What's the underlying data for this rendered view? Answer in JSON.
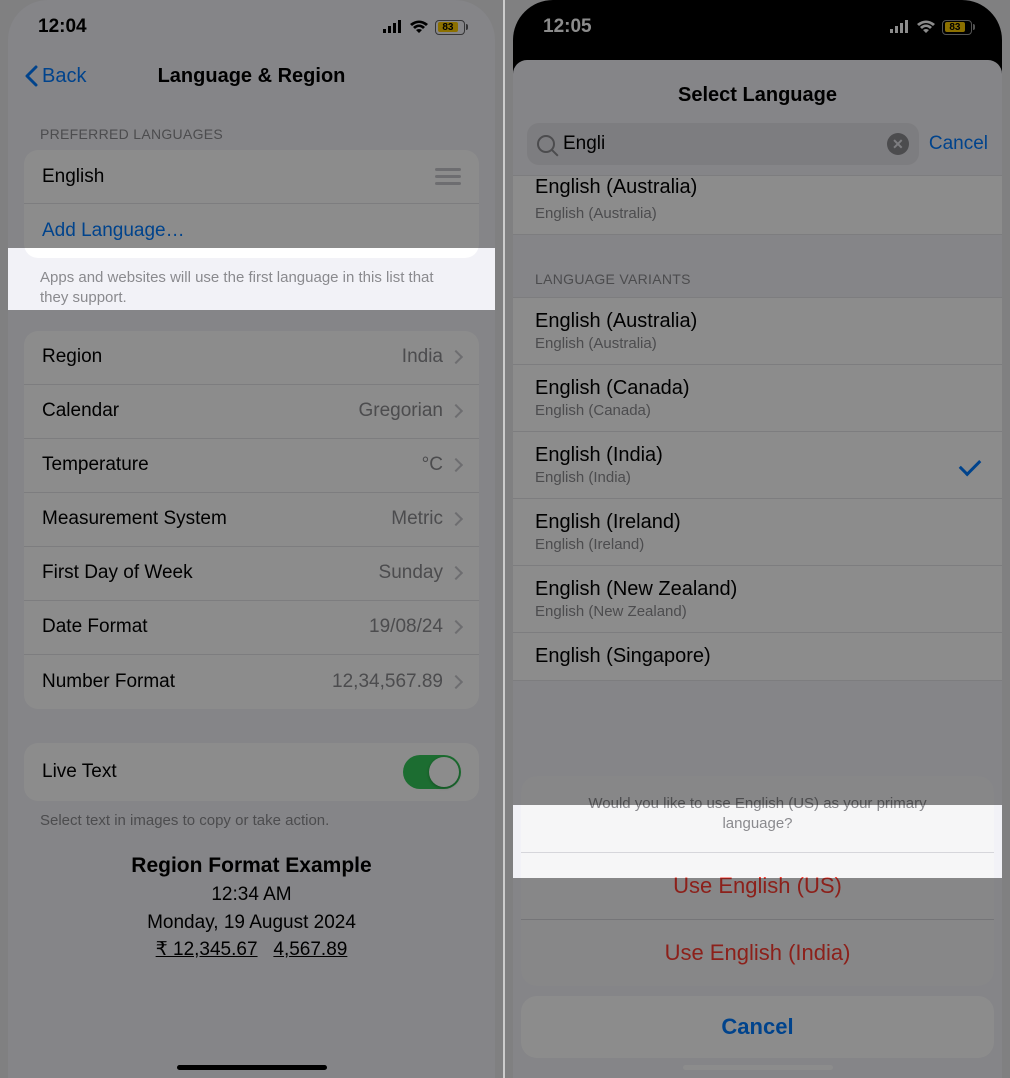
{
  "left": {
    "status": {
      "time": "12:04",
      "battery": "83",
      "battery_pct": 83
    },
    "nav": {
      "back": "Back",
      "title": "Language & Region"
    },
    "pref_header": "PREFERRED LANGUAGES",
    "pref_lang": "English",
    "add_language": "Add Language…",
    "pref_footer": "Apps and websites will use the first language in this list that they support.",
    "rows": {
      "region": {
        "label": "Region",
        "value": "India"
      },
      "calendar": {
        "label": "Calendar",
        "value": "Gregorian"
      },
      "temperature": {
        "label": "Temperature",
        "value": "°C"
      },
      "measurement": {
        "label": "Measurement System",
        "value": "Metric"
      },
      "firstday": {
        "label": "First Day of Week",
        "value": "Sunday"
      },
      "dateformat": {
        "label": "Date Format",
        "value": "19/08/24"
      },
      "numberformat": {
        "label": "Number Format",
        "value": "12,34,567.89"
      }
    },
    "livetext": {
      "label": "Live Text"
    },
    "livetext_footer": "Select text in images to copy or take action.",
    "example": {
      "title": "Region Format Example",
      "time": "12:34 AM",
      "date": "Monday, 19 August 2024",
      "num1": "₹ 12,345.67",
      "num2": "4,567.89"
    }
  },
  "right": {
    "status": {
      "time": "12:05",
      "battery": "83",
      "battery_pct": 83
    },
    "sheet_title": "Select Language",
    "search": {
      "value": "Engli",
      "cancel": "Cancel"
    },
    "partial": {
      "main": "English (Australia)",
      "sub": "English (Australia)"
    },
    "variants_header": "LANGUAGE VARIANTS",
    "variants": [
      {
        "main": "English (Australia)",
        "sub": "English (Australia)",
        "checked": false
      },
      {
        "main": "English (Canada)",
        "sub": "English (Canada)",
        "checked": false
      },
      {
        "main": "English (India)",
        "sub": "English (India)",
        "checked": true
      },
      {
        "main": "English (Ireland)",
        "sub": "English (Ireland)",
        "checked": false
      },
      {
        "main": "English (New Zealand)",
        "sub": "English (New Zealand)",
        "checked": false
      },
      {
        "main": "English (Singapore)",
        "sub": "",
        "checked": false
      }
    ],
    "action": {
      "message": "Would you like to use English (US) as your primary language?",
      "opt1": "Use English (US)",
      "opt2": "Use English (India)",
      "cancel": "Cancel"
    }
  }
}
